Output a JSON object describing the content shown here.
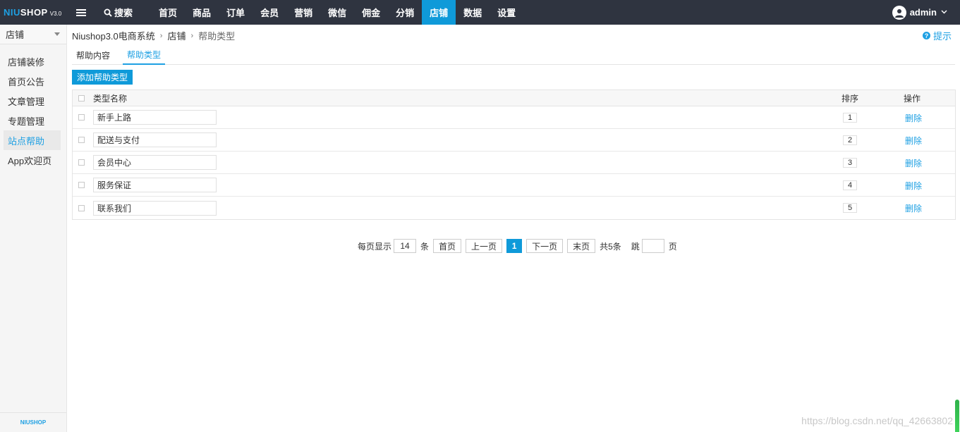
{
  "topbar": {
    "logo_niu": "NIU",
    "logo_shop": "SHOP",
    "logo_version": "V3.0",
    "search_label": "搜索",
    "nav": [
      {
        "label": "首页",
        "active": false
      },
      {
        "label": "商品",
        "active": false
      },
      {
        "label": "订单",
        "active": false
      },
      {
        "label": "会员",
        "active": false
      },
      {
        "label": "营销",
        "active": false
      },
      {
        "label": "微信",
        "active": false
      },
      {
        "label": "佣金",
        "active": false
      },
      {
        "label": "分销",
        "active": false
      },
      {
        "label": "店铺",
        "active": true
      },
      {
        "label": "数据",
        "active": false
      },
      {
        "label": "设置",
        "active": false
      }
    ],
    "username": "admin",
    "accent_color": "#0f9ad9",
    "bg_color": "#2f3440"
  },
  "sidebar": {
    "select_label": "店铺",
    "items": [
      {
        "label": "店铺装修",
        "active": false
      },
      {
        "label": "首页公告",
        "active": false
      },
      {
        "label": "文章管理",
        "active": false
      },
      {
        "label": "专题管理",
        "active": false
      },
      {
        "label": "站点帮助",
        "active": true
      },
      {
        "label": "App欢迎页",
        "active": false
      }
    ],
    "footer_logo": "NIUSHOP"
  },
  "breadcrumb": {
    "items": [
      "Niushop3.0电商系统",
      "店铺"
    ],
    "current": "帮助类型"
  },
  "tips_label": "提示",
  "tabs": [
    {
      "label": "帮助内容",
      "active": false
    },
    {
      "label": "帮助类型",
      "active": true
    }
  ],
  "add_button_label": "添加帮助类型",
  "table": {
    "headers": {
      "name": "类型名称",
      "sort": "排序",
      "op": "操作"
    },
    "rows": [
      {
        "name": "新手上路",
        "sort": "1",
        "op": "删除"
      },
      {
        "name": "配送与支付",
        "sort": "2",
        "op": "删除"
      },
      {
        "name": "会员中心",
        "sort": "3",
        "op": "删除"
      },
      {
        "name": "服务保证",
        "sort": "4",
        "op": "删除"
      },
      {
        "name": "联系我们",
        "sort": "5",
        "op": "删除"
      }
    ]
  },
  "pager": {
    "per_page_label": "每页显示",
    "per_page_value": "14",
    "per_page_unit": "条",
    "first": "首页",
    "prev": "上一页",
    "current": "1",
    "next": "下一页",
    "last": "末页",
    "total": "共5条",
    "jump_label": "跳",
    "jump_unit": "页"
  },
  "watermark": "https://blog.csdn.net/qq_42663802"
}
